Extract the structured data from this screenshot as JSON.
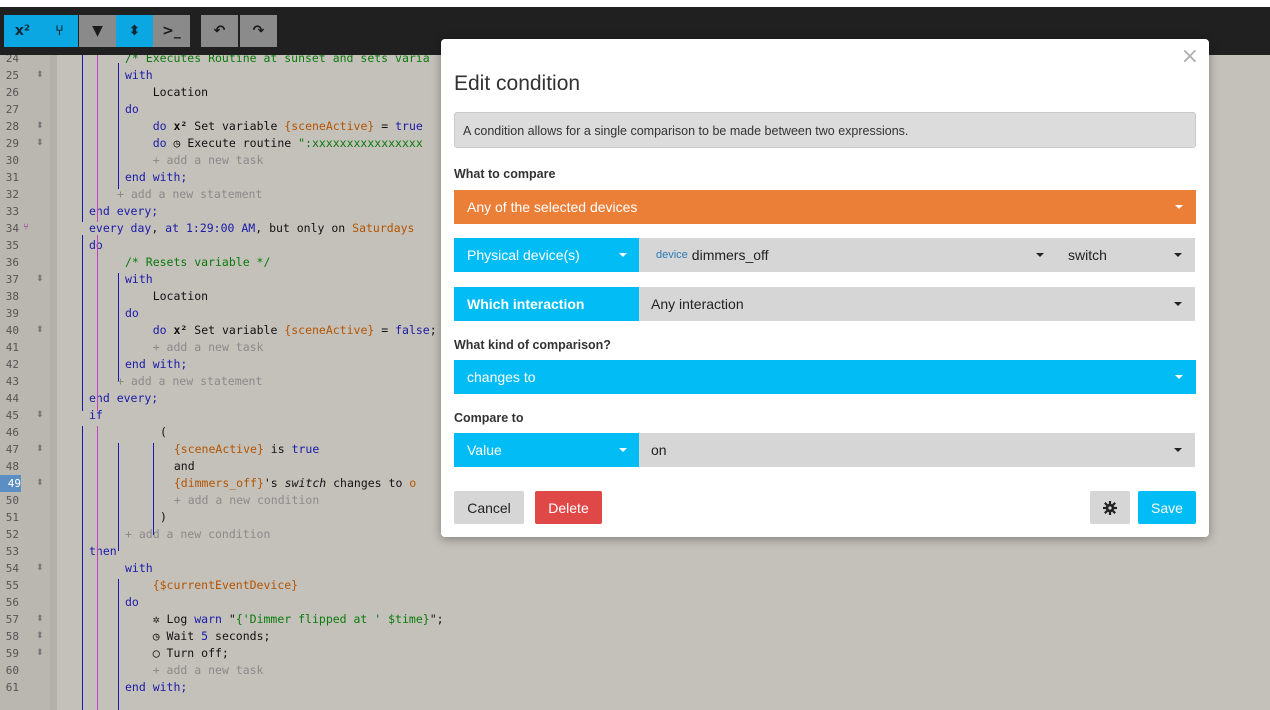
{
  "toolbar": {
    "buttons": [
      {
        "label": "x²"
      },
      {
        "label": "⑂"
      },
      {
        "label": "▼"
      },
      {
        "label": "⬍"
      },
      {
        "label": ">_"
      },
      {
        "label": "↶"
      },
      {
        "label": "↷"
      }
    ]
  },
  "editor": {
    "lines": [
      {
        "n": "24",
        "html": "<span class='cm'>/* Executes Routine at sunset and sets varia</span>"
      },
      {
        "n": "25",
        "html": "<span class='kw'>with</span>"
      },
      {
        "n": "26",
        "html": "    Location"
      },
      {
        "n": "27",
        "html": "<span class='kw'>do</span>"
      },
      {
        "n": "28",
        "html": "    <span class='kw'>do</span> <b>x²</b> Set variable <span class='var'>{sceneActive}</span> = <span class='kw'>true</span>"
      },
      {
        "n": "29",
        "html": "    <span class='kw'>do</span> ◷ Execute routine <span class='str'>\":xxxxxxxxxxxxxxxx</span>"
      },
      {
        "n": "30",
        "html": "    <span class='add'>+ add a new task</span>"
      },
      {
        "n": "31",
        "html": "<span class='kw'>end with;</span>"
      },
      {
        "n": "32",
        "html": "<span class='add'>+ add a new statement</span>"
      },
      {
        "n": "33",
        "html": "<span class='kw'>end every;</span>"
      },
      {
        "n": "34",
        "html": "<span class='kw'>every day</span>, <span class='kw'>at</span> <span class='num'>1:29:00 AM</span>, but only on <span class='var'>Saturdays</span>"
      },
      {
        "n": "35",
        "html": "<span class='kw'>do</span>"
      },
      {
        "n": "36",
        "html": "<span class='cm'>/* Resets variable */</span>"
      },
      {
        "n": "37",
        "html": "<span class='kw'>with</span>"
      },
      {
        "n": "38",
        "html": "    Location"
      },
      {
        "n": "39",
        "html": "<span class='kw'>do</span>"
      },
      {
        "n": "40",
        "html": "    <span class='kw'>do</span> <b>x²</b> Set variable <span class='var'>{sceneActive}</span> = <span class='kw'>false</span>;"
      },
      {
        "n": "41",
        "html": "    <span class='add'>+ add a new task</span>"
      },
      {
        "n": "42",
        "html": "<span class='kw'>end with;</span>"
      },
      {
        "n": "43",
        "html": "<span class='add'>+ add a new statement</span>"
      },
      {
        "n": "44",
        "html": "<span class='kw'>end every;</span>"
      },
      {
        "n": "45",
        "html": "<span class='kw'>if</span>"
      },
      {
        "n": "46",
        "html": "("
      },
      {
        "n": "47",
        "html": "  <span class='var'>{sceneActive}</span> is <span class='kw'>true</span>"
      },
      {
        "n": "48",
        "html": "  and"
      },
      {
        "n": "49",
        "html": "  <span class='var'>{dimmers_off}</span>'s <i>switch</i> changes to <span class='var'>o</span>"
      },
      {
        "n": "50",
        "html": "  <span class='add'>+ add a new condition</span>"
      },
      {
        "n": "51",
        "html": ")"
      },
      {
        "n": "52",
        "html": "<span class='add'>+ add a new condition</span>"
      },
      {
        "n": "53",
        "html": "<span class='kw'>then</span>"
      },
      {
        "n": "54",
        "html": "<span class='kw'>with</span>"
      },
      {
        "n": "55",
        "html": "    <span class='var'>{$currentEventDevice}</span>"
      },
      {
        "n": "56",
        "html": "<span class='kw'>do</span>"
      },
      {
        "n": "57",
        "html": "    ✲ Log <span class='kw'>warn</span> \"<span class='str'>{'Dimmer flipped at ' $time}</span>\";"
      },
      {
        "n": "58",
        "html": "    ◷ Wait <span class='num'>5</span> seconds;"
      },
      {
        "n": "59",
        "html": "    ◯ Turn off;"
      },
      {
        "n": "60",
        "html": "    <span class='add'>+ add a new task</span>"
      },
      {
        "n": "61",
        "html": "<span class='kw'>end with;</span>"
      }
    ]
  },
  "modal": {
    "close": "×",
    "title": "Edit condition",
    "info": "A condition allows for a single comparison to be made between two expressions.",
    "what_to_compare_label": "What to compare",
    "what_to_compare_value": "Any of the selected devices",
    "device_type": "Physical device(s)",
    "device_tag": "device",
    "device_name": "dimmers_off",
    "attribute": "switch",
    "interaction_label": "Which interaction",
    "interaction_value": "Any interaction",
    "comparison_label": "What kind of comparison?",
    "comparison_value": "changes to",
    "compare_to_label": "Compare to",
    "compare_to_type": "Value",
    "compare_to_value": "on",
    "cancel": "Cancel",
    "delete": "Delete",
    "settings_icon": "gear-icon",
    "save": "Save"
  },
  "colors": {
    "orange": "#eb7f38",
    "cyan": "#02bdf5",
    "delete_red": "#e04848"
  }
}
